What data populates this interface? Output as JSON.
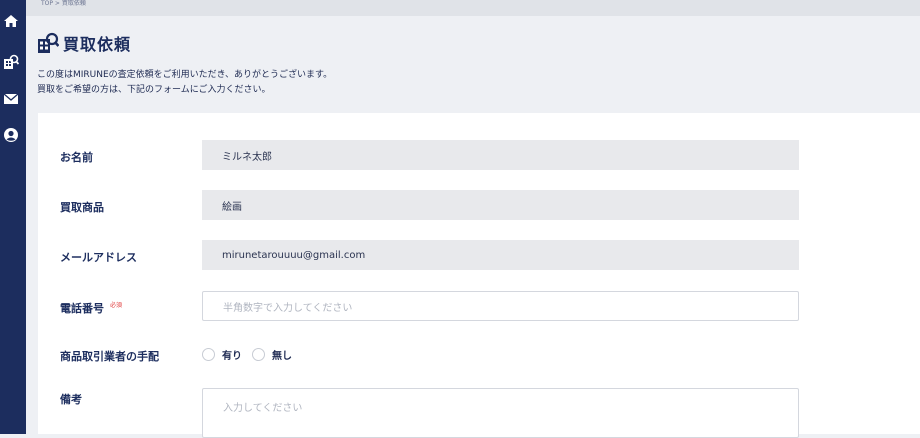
{
  "breadcrumb": "TOP > 買取依頼",
  "page_title": "買取依頼",
  "intro": {
    "line1": "この度はMIRUNEの査定依頼をご利用いただき、ありがとうございます。",
    "line2": "買取をご希望の方は、下記のフォームにご入力ください。"
  },
  "sidebar": {
    "items": [
      {
        "icon": "home-icon"
      },
      {
        "icon": "appraisal-icon"
      },
      {
        "icon": "mail-icon"
      },
      {
        "icon": "user-icon"
      }
    ]
  },
  "form": {
    "name_label": "お名前",
    "name_value": "ミルネ太郎",
    "item_label": "買取商品",
    "item_value": "絵画",
    "email_label": "メールアドレス",
    "email_value": "mirunetarouuuu@gmail.com",
    "phone_label": "電話番号",
    "required_badge": "必須",
    "phone_placeholder": "半角数字で入力してください",
    "dealer_label": "商品取引業者の手配",
    "dealer_options": [
      "有り",
      "無し"
    ],
    "notes_label": "備考",
    "notes_placeholder": "入力してください"
  },
  "colors": {
    "sidebar": "#1c2d5e",
    "background": "#eef0f4",
    "required": "#e03a3a"
  }
}
